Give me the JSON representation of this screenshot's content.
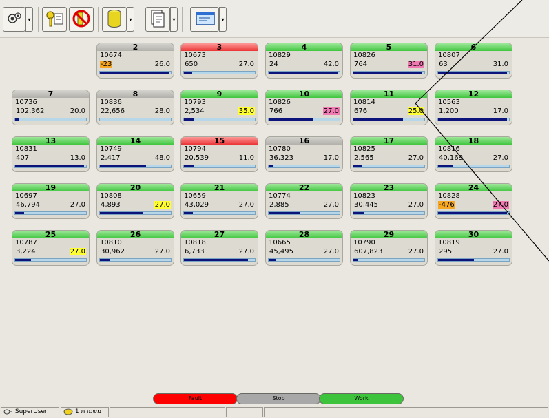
{
  "toolbar": {
    "buttons": [
      {
        "icon": "gear-icon"
      },
      {
        "icon": "key-icon"
      },
      {
        "icon": "no-entry-icon"
      },
      {
        "icon": "database-icon"
      },
      {
        "icon": "document-icon"
      },
      {
        "icon": "window-icon"
      }
    ]
  },
  "stations": [
    {
      "num": "2",
      "id": "10674",
      "count": "-23",
      "value": "26.0",
      "status": "gray",
      "count_hl": "orange",
      "value_hl": "",
      "progress": 0.97
    },
    {
      "num": "3",
      "id": "10673",
      "count": "650",
      "value": "27.0",
      "status": "red",
      "count_hl": "",
      "value_hl": "",
      "progress": 0.12
    },
    {
      "num": "4",
      "id": "10829",
      "count": "24",
      "value": "42.0",
      "status": "green",
      "count_hl": "",
      "value_hl": "",
      "progress": 0.97
    },
    {
      "num": "5",
      "id": "10826",
      "count": "764",
      "value": "31.0",
      "status": "green",
      "count_hl": "",
      "value_hl": "pink",
      "progress": 0.97
    },
    {
      "num": "6",
      "id": "10807",
      "count": "63",
      "value": "31.0",
      "status": "green",
      "count_hl": "",
      "value_hl": "",
      "progress": 0.97
    },
    {
      "num": "7",
      "id": "10736",
      "count": "102,362",
      "value": "20.0",
      "status": "gray",
      "count_hl": "",
      "value_hl": "",
      "progress": 0.06
    },
    {
      "num": "8",
      "id": "10836",
      "count": "22,656",
      "value": "28.0",
      "status": "gray",
      "count_hl": "",
      "value_hl": "",
      "progress": 0.0
    },
    {
      "num": "9",
      "id": "10793",
      "count": "2,534",
      "value": "35.0",
      "status": "green",
      "count_hl": "",
      "value_hl": "yellow",
      "progress": 0.15
    },
    {
      "num": "10",
      "id": "10826",
      "count": "766",
      "value": "27.0",
      "status": "green",
      "count_hl": "",
      "value_hl": "pink",
      "progress": 0.62
    },
    {
      "num": "11",
      "id": "10814",
      "count": "676",
      "value": "25.0",
      "status": "green",
      "count_hl": "",
      "value_hl": "yellow",
      "progress": 0.7
    },
    {
      "num": "12",
      "id": "10563",
      "count": "1,200",
      "value": "17.0",
      "status": "green",
      "count_hl": "",
      "value_hl": "",
      "progress": 0.97
    },
    {
      "num": "13",
      "id": "10831",
      "count": "407",
      "value": "13.0",
      "status": "green",
      "count_hl": "",
      "value_hl": "",
      "progress": 0.97
    },
    {
      "num": "14",
      "id": "10749",
      "count": "2,417",
      "value": "48.0",
      "status": "green",
      "count_hl": "",
      "value_hl": "",
      "progress": 0.65
    },
    {
      "num": "15",
      "id": "10794",
      "count": "20,539",
      "value": "11.0",
      "status": "red",
      "count_hl": "",
      "value_hl": "",
      "progress": 0.15
    },
    {
      "num": "16",
      "id": "10780",
      "count": "36,323",
      "value": "17.0",
      "status": "gray",
      "count_hl": "",
      "value_hl": "",
      "progress": 0.07
    },
    {
      "num": "17",
      "id": "10825",
      "count": "2,565",
      "value": "27.0",
      "status": "green",
      "count_hl": "",
      "value_hl": "",
      "progress": 0.12
    },
    {
      "num": "18",
      "id": "10816",
      "count": "40,169",
      "value": "27.0",
      "status": "green",
      "count_hl": "",
      "value_hl": "",
      "progress": 0.2
    },
    {
      "num": "19",
      "id": "10697",
      "count": "46,794",
      "value": "27.0",
      "status": "green",
      "count_hl": "",
      "value_hl": "",
      "progress": 0.13
    },
    {
      "num": "20",
      "id": "10808",
      "count": "4,893",
      "value": "27.0",
      "status": "green",
      "count_hl": "",
      "value_hl": "yellow",
      "progress": 0.6
    },
    {
      "num": "21",
      "id": "10659",
      "count": "43,029",
      "value": "27.0",
      "status": "green",
      "count_hl": "",
      "value_hl": "",
      "progress": 0.13
    },
    {
      "num": "22",
      "id": "10774",
      "count": "2,885",
      "value": "27.0",
      "status": "green",
      "count_hl": "",
      "value_hl": "",
      "progress": 0.45
    },
    {
      "num": "23",
      "id": "10823",
      "count": "30,445",
      "value": "27.0",
      "status": "green",
      "count_hl": "",
      "value_hl": "",
      "progress": 0.15
    },
    {
      "num": "24",
      "id": "10828",
      "count": "-476",
      "value": "27.0",
      "status": "green",
      "count_hl": "orange",
      "value_hl": "pink",
      "progress": 0.97
    },
    {
      "num": "25",
      "id": "10787",
      "count": "3,224",
      "value": "27.0",
      "status": "green",
      "count_hl": "",
      "value_hl": "yellow",
      "progress": 0.22
    },
    {
      "num": "26",
      "id": "10810",
      "count": "30,962",
      "value": "27.0",
      "status": "green",
      "count_hl": "",
      "value_hl": "",
      "progress": 0.14
    },
    {
      "num": "27",
      "id": "10818",
      "count": "6,733",
      "value": "27.0",
      "status": "green",
      "count_hl": "",
      "value_hl": "",
      "progress": 0.9
    },
    {
      "num": "28",
      "id": "10665",
      "count": "45,495",
      "value": "27.0",
      "status": "green",
      "count_hl": "",
      "value_hl": "",
      "progress": 0.1
    },
    {
      "num": "29",
      "id": "10790",
      "count": "607,823",
      "value": "27.0",
      "status": "green",
      "count_hl": "",
      "value_hl": "",
      "progress": 0.06
    },
    {
      "num": "30",
      "id": "10819",
      "count": "295",
      "value": "27.0",
      "status": "green",
      "count_hl": "",
      "value_hl": "",
      "progress": 0.5
    }
  ],
  "legend": {
    "fault": {
      "label": "Fault",
      "color": "#ff0000"
    },
    "stop": {
      "label": "Stop",
      "color": "#a8a8a8"
    },
    "work": {
      "label": "Work",
      "color": "#3ec43c"
    }
  },
  "statusbar": {
    "user": "SuperUser",
    "shift_label": "משמרת",
    "shift_num": "1"
  }
}
